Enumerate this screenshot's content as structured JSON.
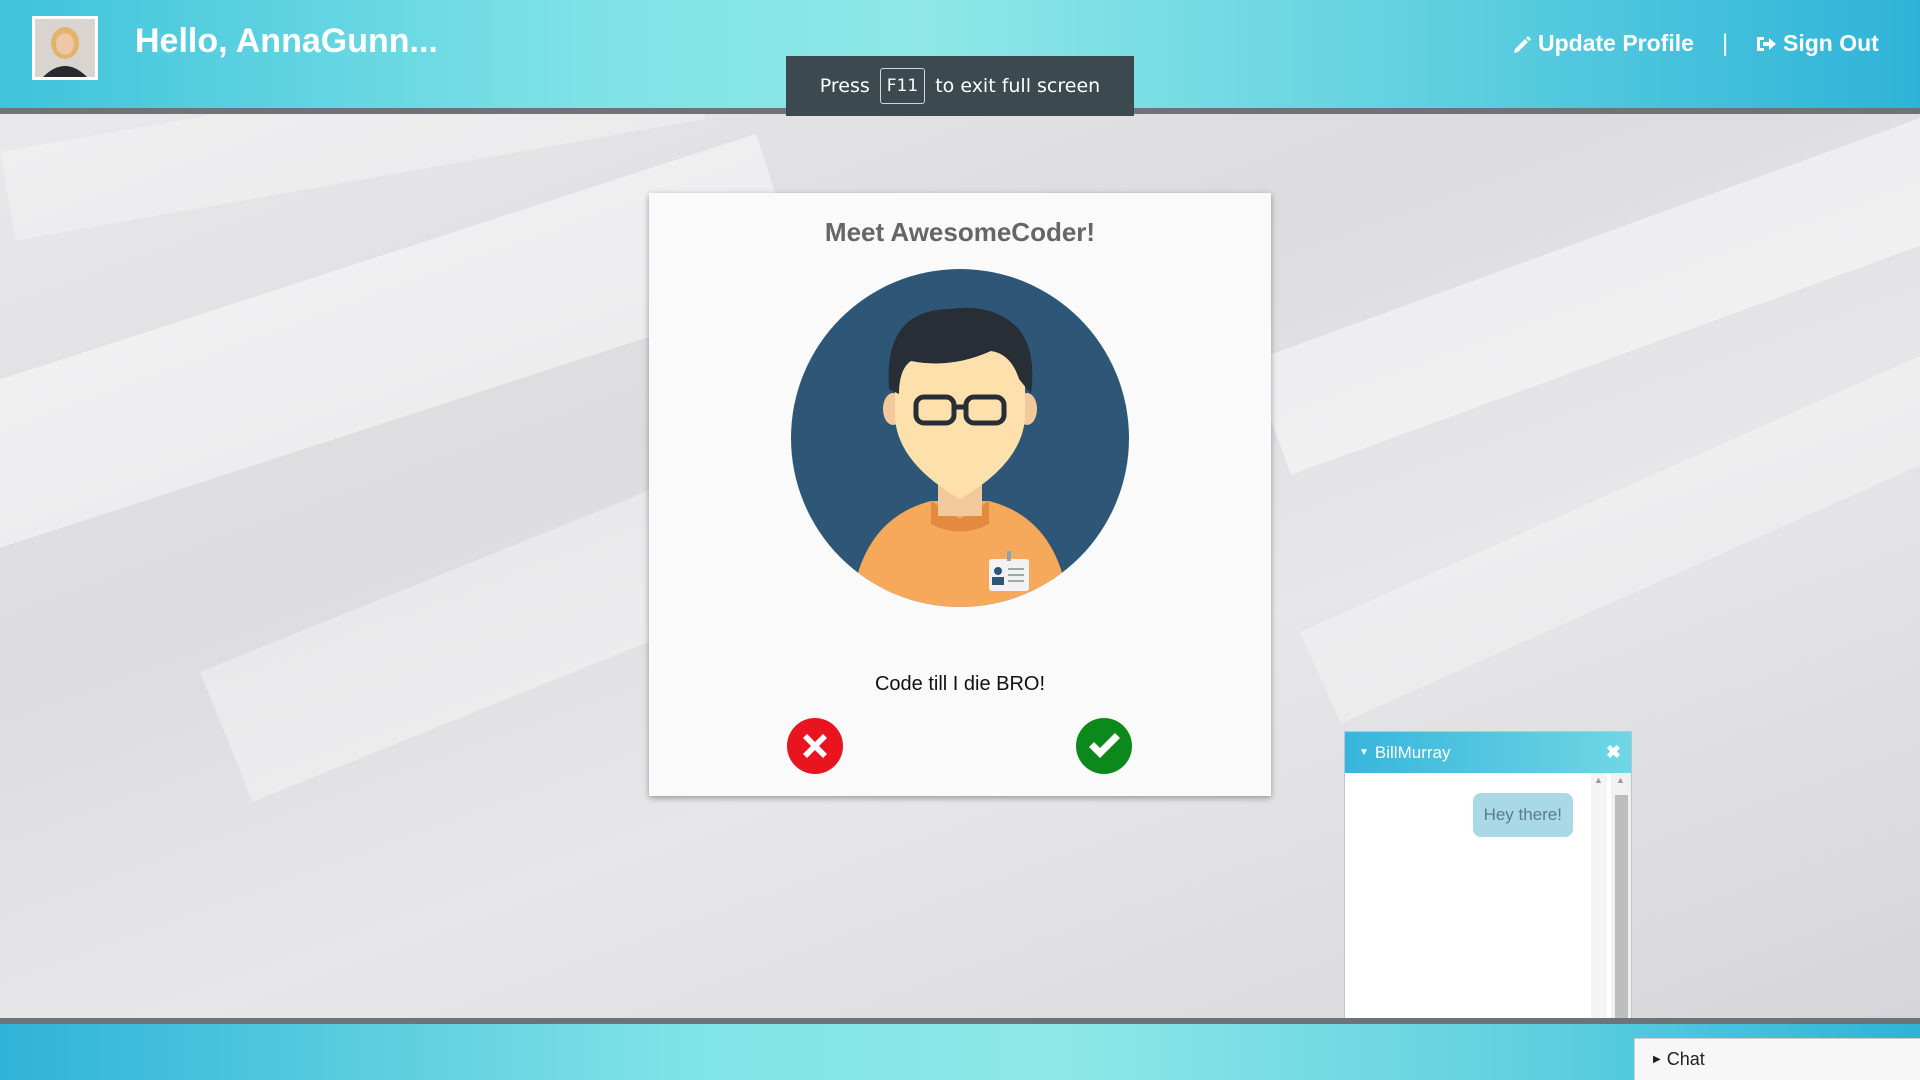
{
  "header": {
    "greeting": "Hello, AnnaGunn...",
    "update_profile": "Update Profile",
    "separator": "|",
    "sign_out": "Sign Out"
  },
  "toast": {
    "press": "Press",
    "key": "F11",
    "message": "to exit full screen"
  },
  "card": {
    "title": "Meet AwesomeCoder!",
    "bio": "Code till I die BRO!"
  },
  "chat_window": {
    "title": "BillMurray",
    "close_icon": "close-icon",
    "messages": [
      "Hey there!"
    ]
  },
  "chat_tab": {
    "label": "Chat"
  },
  "colors": {
    "header_accent": "#3fc3dc",
    "reject": "#e8141f",
    "accept": "#0b8a1b",
    "portrait_bg": "#2e5777"
  }
}
